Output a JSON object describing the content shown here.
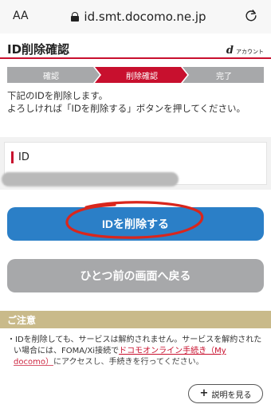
{
  "browser": {
    "text_size_label": "AA",
    "url": "id.smt.docomo.ne.jp"
  },
  "header": {
    "title": "ID削除確認",
    "brand_letter": "d",
    "brand_text": "アカウント"
  },
  "steps": [
    {
      "label": "確認",
      "state": "done"
    },
    {
      "label": "削除確認",
      "state": "current"
    },
    {
      "label": "完了",
      "state": "todo"
    }
  ],
  "message": {
    "line1": "下記のIDを削除します。",
    "line2": "よろしければ「IDを削除する」ボタンを押してください。"
  },
  "id_field": {
    "label": "ID"
  },
  "buttons": {
    "delete": "IDを削除する",
    "back": "ひとつ前の画面へ戻る"
  },
  "notice": {
    "title": "ご注意",
    "text_before": "・IDを削除しても、サービスは解約されません。サービスを解約されたい場合には、FOMA/Xi接続で",
    "link": "ドコモオンライン手続き（My docomo）",
    "text_after": "にアクセスし、手続きを行ってください。"
  },
  "help": {
    "label": "説明を見る"
  },
  "colors": {
    "accent_red": "#c8102e",
    "step_done": "#a7a8aa",
    "step_current": "#c8102e",
    "button_primary": "#2b7fc7",
    "button_secondary": "#a7a8aa",
    "notice_bar": "#c9ba8a"
  }
}
